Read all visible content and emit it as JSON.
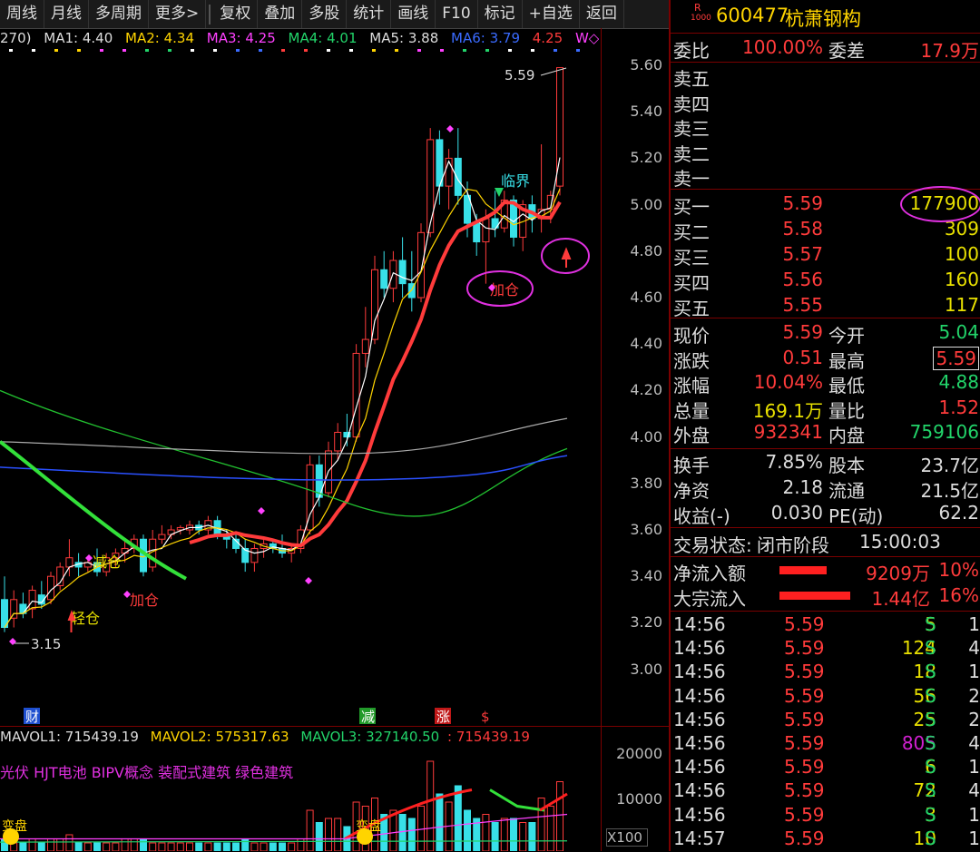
{
  "toolbar": {
    "items": [
      "周线",
      "月线",
      "多周期",
      "更多>",
      "复权",
      "叠加",
      "多股",
      "统计",
      "画线",
      "F10",
      "标记",
      "+自选",
      "返回"
    ]
  },
  "ma_line": {
    "prefix": "270)",
    "ma1": "MA1: 4.40",
    "ma2": "MA2: 4.34",
    "ma3": "MA3: 4.25",
    "ma4": "MA4: 4.01",
    "ma5": "MA5: 3.88",
    "ma6": "MA6: 3.79",
    "extra": "4.25",
    "w": "W◇"
  },
  "y_axis": [
    "5.60",
    "5.40",
    "5.20",
    "5.00",
    "4.80",
    "4.60",
    "4.40",
    "4.20",
    "4.00",
    "3.80",
    "3.60",
    "3.40",
    "3.20",
    "3.00"
  ],
  "annotations": {
    "high": "5.59",
    "low": "3.15",
    "linjie": "临界",
    "jiacang1": "加仓",
    "jiacang2": "加仓",
    "jiancang": "减仓",
    "qingcang": "轻仓"
  },
  "bottom_markers": [
    "财",
    "减",
    "涨",
    "$"
  ],
  "volume": {
    "mavol1": "MAVOL1: 715439.19",
    "mavol2": "MAVOL2: 575317.63",
    "mavol3": "MAVOL3: 327140.50",
    "mavol4": ": 715439.19",
    "concepts": "光伏 HJT电池 BIPV概念 装配式建筑 绿色建筑",
    "axis": [
      "20000",
      "10000"
    ],
    "unit": "X100",
    "label1": "变盘",
    "label2": "变盘"
  },
  "quote": {
    "flag": "R",
    "flag_sub": "1000",
    "code": "600477",
    "name": "杭萧钢构",
    "weibi_label": "委比",
    "weibi": "100.00%",
    "weicha_label": "委差",
    "weicha": "17.9万",
    "sells": [
      {
        "label": "卖五",
        "price": "",
        "vol": ""
      },
      {
        "label": "卖四",
        "price": "",
        "vol": ""
      },
      {
        "label": "卖三",
        "price": "",
        "vol": ""
      },
      {
        "label": "卖二",
        "price": "",
        "vol": ""
      },
      {
        "label": "卖一",
        "price": "",
        "vol": ""
      }
    ],
    "buys": [
      {
        "label": "买一",
        "price": "5.59",
        "vol": "177900"
      },
      {
        "label": "买二",
        "price": "5.58",
        "vol": "309"
      },
      {
        "label": "买三",
        "price": "5.57",
        "vol": "100"
      },
      {
        "label": "买四",
        "price": "5.56",
        "vol": "160"
      },
      {
        "label": "买五",
        "price": "5.55",
        "vol": "117"
      }
    ],
    "stats": [
      {
        "l1": "现价",
        "v1": "5.59",
        "c1": "red",
        "l2": "今开",
        "v2": "5.04",
        "c2": "green"
      },
      {
        "l1": "涨跌",
        "v1": "0.51",
        "c1": "red",
        "l2": "最高",
        "v2": "5.59",
        "c2": "red"
      },
      {
        "l1": "涨幅",
        "v1": "10.04%",
        "c1": "red",
        "l2": "最低",
        "v2": "4.88",
        "c2": "green"
      },
      {
        "l1": "总量",
        "v1": "169.1万",
        "c1": "yellow",
        "l2": "量比",
        "v2": "1.52",
        "c2": "red"
      },
      {
        "l1": "外盘",
        "v1": "932341",
        "c1": "red",
        "l2": "内盘",
        "v2": "759106",
        "c2": "green"
      }
    ],
    "stats2": [
      {
        "l1": "换手",
        "v1": "7.85%",
        "l2": "股本",
        "v2": "23.7亿"
      },
      {
        "l1": "净资",
        "v1": "2.18",
        "l2": "流通",
        "v2": "21.5亿"
      },
      {
        "l1": "收益(-)",
        "v1": "0.030",
        "l2": "PE(动)",
        "v2": "62.2"
      }
    ],
    "status_label": "交易状态:",
    "status": "闭市阶段",
    "status_time": "15:00:03",
    "flow": [
      {
        "label": "净流入额",
        "value": "9209万",
        "pct": "10%",
        "bar": 0.2
      },
      {
        "label": "大宗流入",
        "value": "1.44亿",
        "pct": "16%",
        "bar": 0.3
      }
    ],
    "ticks": [
      {
        "t": "14:56",
        "p": "5.59",
        "v": "5",
        "vc": "yellow",
        "s": "S",
        "n": "1"
      },
      {
        "t": "14:56",
        "p": "5.59",
        "v": "124",
        "vc": "yellow",
        "s": "S",
        "n": "4"
      },
      {
        "t": "14:56",
        "p": "5.59",
        "v": "18",
        "vc": "yellow",
        "s": "S",
        "n": "1"
      },
      {
        "t": "14:56",
        "p": "5.59",
        "v": "56",
        "vc": "yellow",
        "s": "S",
        "n": "2"
      },
      {
        "t": "14:56",
        "p": "5.59",
        "v": "25",
        "vc": "yellow",
        "s": "S",
        "n": "2"
      },
      {
        "t": "14:56",
        "p": "5.59",
        "v": "805",
        "vc": "purple",
        "s": "S",
        "n": "4"
      },
      {
        "t": "14:56",
        "p": "5.59",
        "v": "6",
        "vc": "yellow",
        "s": "S",
        "n": "1"
      },
      {
        "t": "14:56",
        "p": "5.59",
        "v": "72",
        "vc": "yellow",
        "s": "S",
        "n": "4"
      },
      {
        "t": "14:56",
        "p": "5.59",
        "v": "3",
        "vc": "yellow",
        "s": "S",
        "n": "1"
      },
      {
        "t": "14:57",
        "p": "5.59",
        "v": "10",
        "vc": "yellow",
        "s": "S",
        "n": "1"
      }
    ]
  },
  "chart_data": {
    "type": "candlestick",
    "y_range": [
      3.0,
      5.65
    ],
    "candles": [
      [
        3.3,
        3.4,
        3.16,
        3.18
      ],
      [
        3.22,
        3.34,
        3.18,
        3.3
      ],
      [
        3.28,
        3.33,
        3.22,
        3.24
      ],
      [
        3.26,
        3.36,
        3.22,
        3.34
      ],
      [
        3.32,
        3.38,
        3.26,
        3.28
      ],
      [
        3.3,
        3.42,
        3.28,
        3.4
      ],
      [
        3.36,
        3.46,
        3.34,
        3.44
      ],
      [
        3.44,
        3.56,
        3.4,
        3.48
      ],
      [
        3.46,
        3.5,
        3.4,
        3.44
      ],
      [
        3.44,
        3.48,
        3.42,
        3.46
      ],
      [
        3.46,
        3.52,
        3.4,
        3.42
      ],
      [
        3.42,
        3.5,
        3.4,
        3.48
      ],
      [
        3.48,
        3.52,
        3.44,
        3.5
      ],
      [
        3.5,
        3.56,
        3.46,
        3.52
      ],
      [
        3.52,
        3.58,
        3.5,
        3.56
      ],
      [
        3.56,
        3.58,
        3.4,
        3.42
      ],
      [
        3.44,
        3.6,
        3.42,
        3.56
      ],
      [
        3.56,
        3.62,
        3.54,
        3.58
      ],
      [
        3.58,
        3.62,
        3.56,
        3.6
      ],
      [
        3.6,
        3.62,
        3.58,
        3.61
      ],
      [
        3.6,
        3.64,
        3.58,
        3.62
      ],
      [
        3.62,
        3.64,
        3.58,
        3.6
      ],
      [
        3.6,
        3.66,
        3.58,
        3.64
      ],
      [
        3.64,
        3.66,
        3.56,
        3.58
      ],
      [
        3.58,
        3.6,
        3.52,
        3.56
      ],
      [
        3.56,
        3.58,
        3.5,
        3.52
      ],
      [
        3.52,
        3.56,
        3.42,
        3.46
      ],
      [
        3.46,
        3.54,
        3.42,
        3.52
      ],
      [
        3.52,
        3.56,
        3.48,
        3.54
      ],
      [
        3.54,
        3.56,
        3.5,
        3.52
      ],
      [
        3.52,
        3.58,
        3.48,
        3.5
      ],
      [
        3.5,
        3.54,
        3.46,
        3.52
      ],
      [
        3.52,
        3.62,
        3.5,
        3.6
      ],
      [
        3.6,
        3.92,
        3.58,
        3.88
      ],
      [
        3.88,
        3.92,
        3.7,
        3.74
      ],
      [
        3.76,
        3.98,
        3.74,
        3.94
      ],
      [
        3.94,
        4.06,
        3.9,
        4.02
      ],
      [
        4.02,
        4.1,
        3.96,
        4.0
      ],
      [
        4.0,
        4.4,
        3.98,
        4.36
      ],
      [
        4.36,
        4.56,
        4.3,
        4.42
      ],
      [
        4.42,
        4.78,
        4.4,
        4.72
      ],
      [
        4.72,
        4.8,
        4.6,
        4.64
      ],
      [
        4.64,
        4.8,
        4.58,
        4.76
      ],
      [
        4.76,
        4.86,
        4.6,
        4.66
      ],
      [
        4.66,
        4.8,
        4.54,
        4.6
      ],
      [
        4.6,
        4.92,
        4.58,
        4.88
      ],
      [
        4.88,
        5.33,
        4.86,
        5.28
      ],
      [
        5.28,
        5.32,
        5.0,
        5.08
      ],
      [
        5.08,
        5.24,
        4.98,
        5.2
      ],
      [
        5.2,
        5.33,
        5.0,
        5.04
      ],
      [
        5.04,
        5.1,
        4.86,
        4.92
      ],
      [
        4.92,
        4.96,
        4.78,
        4.84
      ],
      [
        4.84,
        4.98,
        4.66,
        4.94
      ],
      [
        4.94,
        5.06,
        4.86,
        4.9
      ],
      [
        4.9,
        5.06,
        4.88,
        5.02
      ],
      [
        5.02,
        5.04,
        4.82,
        4.86
      ],
      [
        4.86,
        5.02,
        4.8,
        5.0
      ],
      [
        5.0,
        5.04,
        4.88,
        4.94
      ],
      [
        4.94,
        5.26,
        4.88,
        4.98
      ],
      [
        4.98,
        5.06,
        4.92,
        5.04
      ],
      [
        5.08,
        5.59,
        5.04,
        5.59
      ]
    ],
    "volumes": [
      3,
      2,
      2,
      3,
      2,
      3,
      3,
      4,
      2,
      2,
      2,
      2,
      2,
      3,
      3,
      3,
      2,
      2,
      2,
      2,
      2,
      2,
      2,
      2,
      2,
      2,
      3,
      2,
      2,
      2,
      2,
      2,
      3,
      10,
      7,
      8,
      8,
      6,
      12,
      11,
      13,
      9,
      10,
      9,
      8,
      11,
      22,
      14,
      12,
      16,
      10,
      8,
      9,
      7,
      8,
      8,
      7,
      7,
      13,
      11,
      17
    ]
  }
}
